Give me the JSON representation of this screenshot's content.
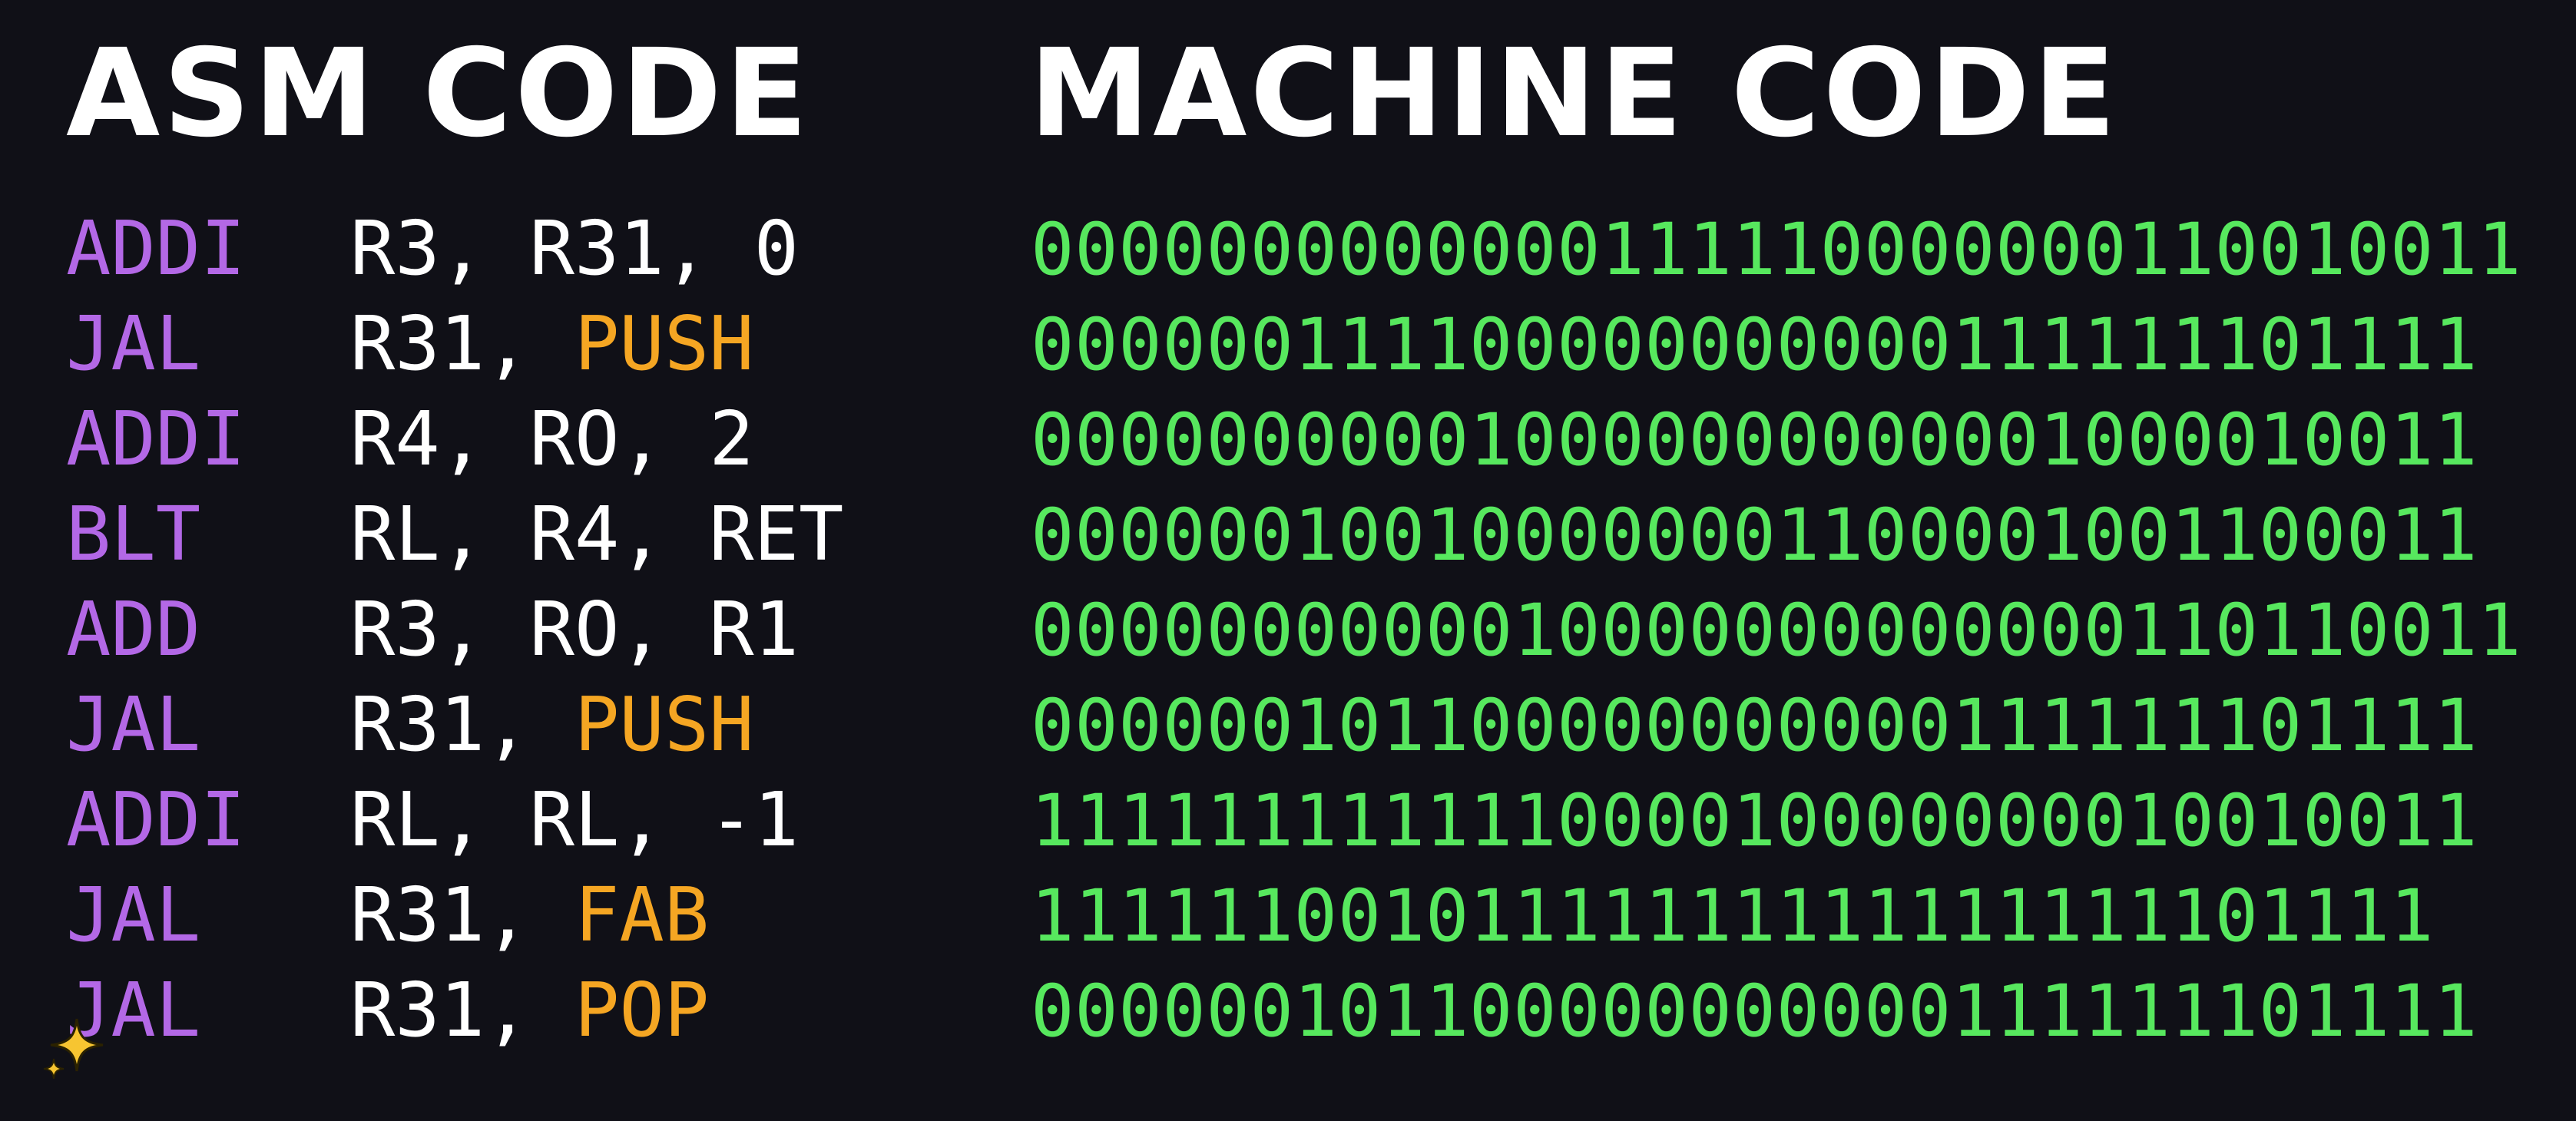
{
  "headings": {
    "asm": "ASM CODE",
    "machine": "MACHINE CODE"
  },
  "asm": [
    {
      "op": "ADDI",
      "args": [
        "R3,",
        "R31,",
        "0"
      ],
      "label": ""
    },
    {
      "op": "JAL",
      "args": [
        "R31,"
      ],
      "label": "PUSH"
    },
    {
      "op": "ADDI",
      "args": [
        "R4,",
        "RO,",
        "2"
      ],
      "label": ""
    },
    {
      "op": "BLT",
      "args": [
        "RL,",
        "R4,",
        "RET"
      ],
      "label": ""
    },
    {
      "op": "ADD",
      "args": [
        "R3,",
        "RO,",
        "R1"
      ],
      "label": ""
    },
    {
      "op": "JAL",
      "args": [
        "R31,"
      ],
      "label": "PUSH"
    },
    {
      "op": "ADDI",
      "args": [
        "RL,",
        "RL,",
        "-1"
      ],
      "label": ""
    },
    {
      "op": "JAL",
      "args": [
        "R31,"
      ],
      "label": "FAB"
    },
    {
      "op": "JAL",
      "args": [
        "R31,"
      ],
      "label": "POP"
    }
  ],
  "machine": [
    "00000000000001111100000001100100 11",
    "00000011110000000000011111110111 1",
    "00000000001000000000000100001001 1",
    "00000010010000000110000100110001 1",
    "00000000000100000000000001101100 11",
    "00000010110000000000011111110111 1",
    "11111111111100001000000001001001 1",
    "11111100101111111111111111101111",
    "00000010110000000000011111110111 1"
  ],
  "icons": {
    "sparkle": "sparkle-icon"
  },
  "colors": {
    "background": "#101017",
    "heading": "#ffffff",
    "opcode": "#b368e6",
    "operand": "#ffffff",
    "label": "#f5a623",
    "binary": "#57e85e",
    "sparkle": "#f7c531"
  }
}
